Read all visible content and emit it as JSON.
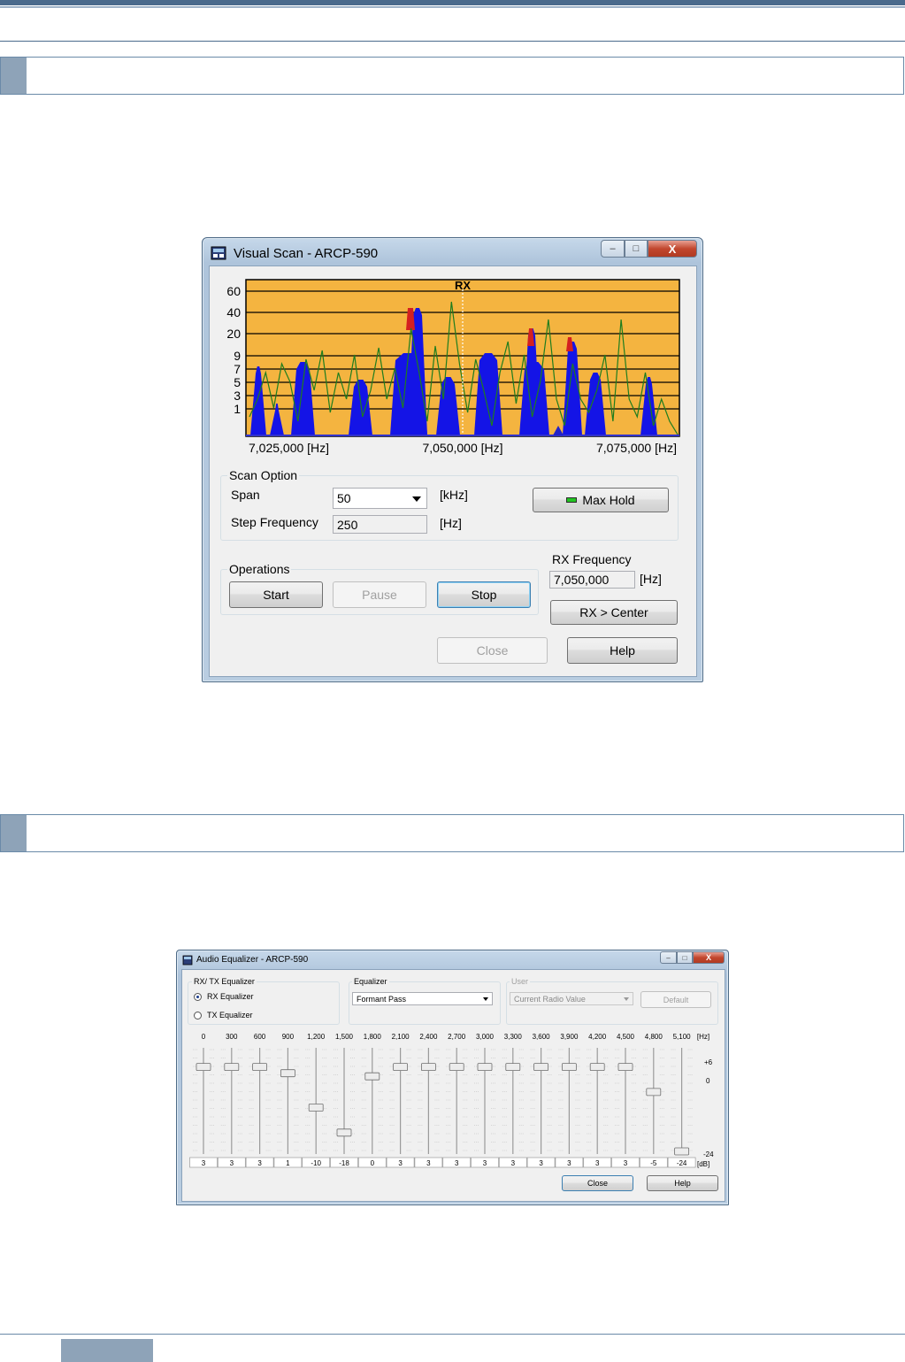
{
  "visual_scan": {
    "title": "Visual Scan - ARCP-590",
    "icon": "radio-app-icon",
    "caption_buttons": {
      "minimize": "–",
      "maximize": "□",
      "close": "X"
    },
    "chart": {
      "rx_label": "RX",
      "y_ticks": [
        "60",
        "40",
        "20",
        "9",
        "7",
        "5",
        "3",
        "1"
      ],
      "x_ticks": [
        "7,025,000 [Hz]",
        "7,050,000 [Hz]",
        "7,075,000 [Hz]"
      ]
    },
    "scan_option": {
      "group_label": "Scan Option",
      "span_label": "Span",
      "span_value": "50",
      "span_unit": "[kHz]",
      "step_label": "Step Frequency",
      "step_value": "250",
      "step_unit": "[Hz]",
      "max_hold_label": "Max Hold",
      "max_hold_indicator_color": "#21c421"
    },
    "operations": {
      "group_label": "Operations",
      "start_label": "Start",
      "pause_label": "Pause",
      "stop_label": "Stop"
    },
    "rx_frequency": {
      "label": "RX Frequency",
      "value": "7,050,000",
      "unit": "[Hz]",
      "center_button": "RX > Center"
    },
    "close_label": "Close",
    "help_label": "Help"
  },
  "audio_equalizer": {
    "title": "Audio Equalizer - ARCP-590",
    "icon": "radio-app-icon",
    "caption_buttons": {
      "minimize": "–",
      "maximize": "□",
      "close": "X"
    },
    "rxtx_group_label": "RX/ TX Equalizer",
    "rx_option": "RX Equalizer",
    "tx_option": "TX Equalizer",
    "rx_selected": true,
    "equalizer_group_label": "Equalizer",
    "equalizer_value": "Formant Pass",
    "user_group_label": "User",
    "user_value": "Current Radio Value",
    "default_label": "Default",
    "hz_unit": "[Hz]",
    "db_unit": "[dB]",
    "scale_top": "+6",
    "scale_mid": "0",
    "scale_bottom": "-24",
    "bands": [
      {
        "freq": "0",
        "value": "3",
        "level": 3
      },
      {
        "freq": "300",
        "value": "3",
        "level": 3
      },
      {
        "freq": "600",
        "value": "3",
        "level": 3
      },
      {
        "freq": "900",
        "value": "1",
        "level": 1
      },
      {
        "freq": "1,200",
        "value": "-10",
        "level": -10
      },
      {
        "freq": "1,500",
        "value": "-18",
        "level": -18
      },
      {
        "freq": "1,800",
        "value": "0",
        "level": 0
      },
      {
        "freq": "2,100",
        "value": "3",
        "level": 3
      },
      {
        "freq": "2,400",
        "value": "3",
        "level": 3
      },
      {
        "freq": "2,700",
        "value": "3",
        "level": 3
      },
      {
        "freq": "3,000",
        "value": "3",
        "level": 3
      },
      {
        "freq": "3,300",
        "value": "3",
        "level": 3
      },
      {
        "freq": "3,600",
        "value": "3",
        "level": 3
      },
      {
        "freq": "3,900",
        "value": "3",
        "level": 3
      },
      {
        "freq": "4,200",
        "value": "3",
        "level": 3
      },
      {
        "freq": "4,500",
        "value": "3",
        "level": 3
      },
      {
        "freq": "4,800",
        "value": "-5",
        "level": -5
      },
      {
        "freq": "5,100",
        "value": "-24",
        "level": -24
      }
    ],
    "close_label": "Close",
    "help_label": "Help"
  }
}
